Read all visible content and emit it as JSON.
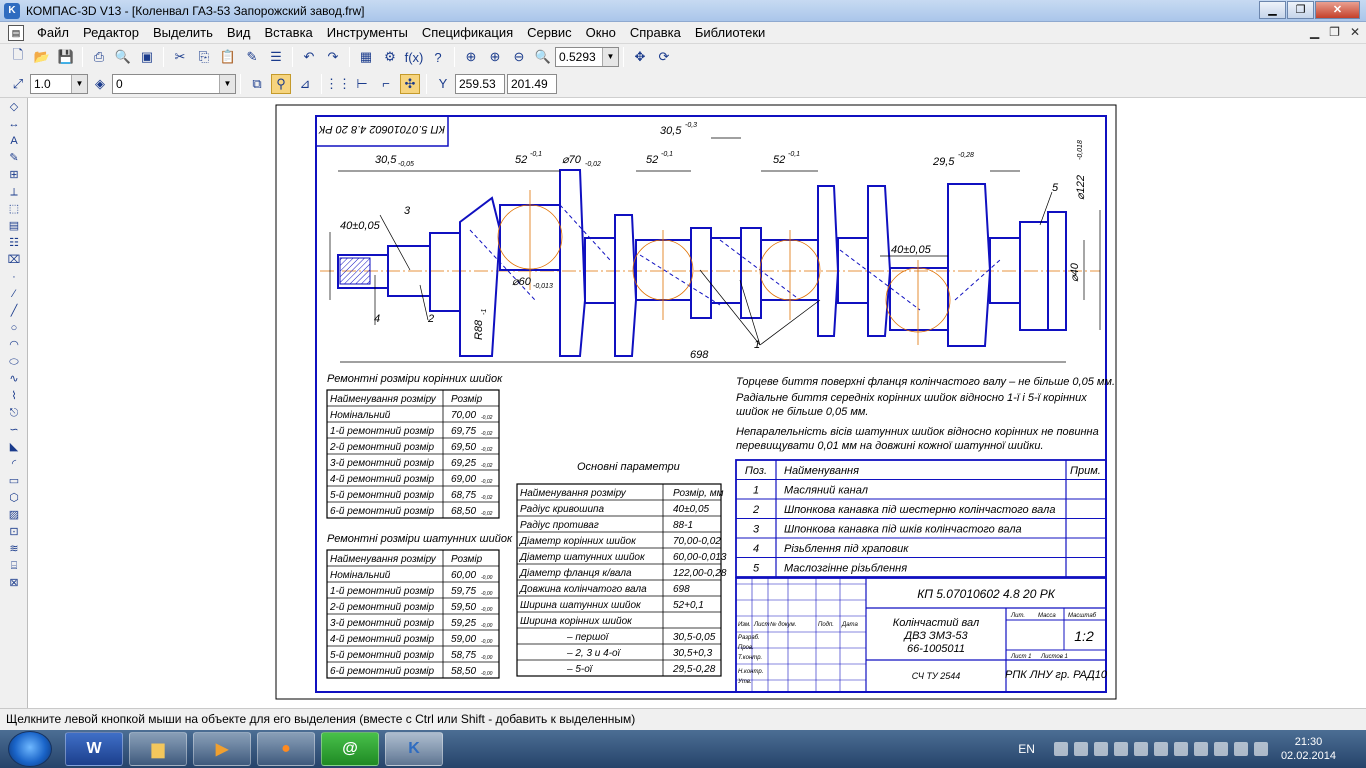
{
  "window": {
    "title": "КОМПАС-3D V13 - [Коленвал ГАЗ-53 Запорожский завод.frw]",
    "app_icon": "kompas-logo-icon"
  },
  "menu": [
    "Файл",
    "Редактор",
    "Выделить",
    "Вид",
    "Вставка",
    "Инструменты",
    "Спецификация",
    "Сервис",
    "Окно",
    "Справка",
    "Библиотеки"
  ],
  "toolbar1": {
    "zoom_value": "0.5293"
  },
  "toolbar2": {
    "scale_value": "1.0",
    "layer_value": "0",
    "coord_x": "259.53",
    "coord_y": "201.49"
  },
  "status": {
    "text": "Щелкните левой кнопкой мыши на объекте для его выделения (вместе с Ctrl или Shift - добавить к выделенным)"
  },
  "taskbar": {
    "items": [
      "W"
    ],
    "lang": "EN",
    "time": "21:30",
    "date": "02.02.2014"
  },
  "drawing": {
    "stamp_top": "КП 5.07010602 4.8 20 РК",
    "dims": {
      "d1": "30,5",
      "d1_tol": "-0,05",
      "d2": "52",
      "d2_tol": "-0,1",
      "d3": "⌀70",
      "d3_tol": "-0,02",
      "d4": "52",
      "d4_tol": "-0,1",
      "d5": "30,5",
      "d5_tol": "-0,3",
      "d6": "52",
      "d6_tol": "-0,1",
      "d7": "29,5",
      "d7_tol": "-0,28",
      "d8": "⌀122",
      "d8_tol": "-0,018",
      "d9": "40±0,05",
      "d10": "40±0,05",
      "d11": "⌀60",
      "d11_tol": "-0,013",
      "d12": "R88",
      "d12_tol": "-1",
      "d13": "⌀40",
      "d14": "698",
      "leaders": [
        "3",
        "4",
        "2",
        "1",
        "5"
      ]
    },
    "main_table": {
      "title": "Ремонтні розміри корінних шийок",
      "headers": [
        "Найменування розміру",
        "Розмір"
      ],
      "rows": [
        [
          "Номінальний",
          "70,00"
        ],
        [
          "1-й ремонтний розмір",
          "69,75"
        ],
        [
          "2-й ремонтний розмір",
          "69,50"
        ],
        [
          "3-й ремонтний розмір",
          "69,25"
        ],
        [
          "4-й ремонтний розмір",
          "69,00"
        ],
        [
          "5-й ремонтний розмір",
          "68,75"
        ],
        [
          "6-й ремонтний розмір",
          "68,50"
        ]
      ],
      "tol": "-0,02"
    },
    "rod_table": {
      "title": "Ремонтні розміри шатунних шийок",
      "headers": [
        "Найменування розміру",
        "Розмір"
      ],
      "rows": [
        [
          "Номінальний",
          "60,00"
        ],
        [
          "1-й ремонтний розмір",
          "59,75"
        ],
        [
          "2-й ремонтний розмір",
          "59,50"
        ],
        [
          "3-й ремонтний розмір",
          "59,25"
        ],
        [
          "4-й ремонтний розмір",
          "59,00"
        ],
        [
          "5-й ремонтний розмір",
          "58,75"
        ],
        [
          "6-й ремонтний розмір",
          "58,50"
        ]
      ],
      "tol": "-0,00"
    },
    "params_table": {
      "title": "Основні параметри",
      "headers": [
        "Найменування розміру",
        "Розмір, мм"
      ],
      "rows": [
        [
          "Радіус кривошипа",
          "40±0,05"
        ],
        [
          "Радіус противаг",
          "88-1"
        ],
        [
          "Діаметр корінних шийок",
          "70,00-0,02"
        ],
        [
          "Діаметр шатунних шийок",
          "60,00-0,013"
        ],
        [
          "Діаметр фланця к/вала",
          "122,00-0,28"
        ],
        [
          "Довжина колінчатого вала",
          "698"
        ],
        [
          "Ширина шатунних шийок",
          "52+0,1"
        ],
        [
          "Ширина корінних шийок",
          ""
        ],
        [
          "– першої",
          "30,5-0,05"
        ],
        [
          "– 2, 3 и 4-ої",
          "30,5+0,3"
        ],
        [
          "– 5-ої",
          "29,5-0,28"
        ]
      ]
    },
    "notes": [
      "Торцеве биття поверхні фланця колінчастого валу – не більше 0,05 мм.",
      "Радіальне биття середніх корінних шийок відносно 1-ї і 5-ї корінних",
      "шийок не більше 0,05 мм.",
      "Непаралельність вісів шатунних шийок відносно корінних не повинна",
      "перевищувати 0,01 мм на довжині кожної шатунної шийки."
    ],
    "spec_table": {
      "headers": [
        "Поз.",
        "Найменування",
        "Прим."
      ],
      "rows": [
        [
          "1",
          "Масляний канал"
        ],
        [
          "2",
          "Шпонкова канавка під шестерню колінчастого вала"
        ],
        [
          "3",
          "Шпонкова канавка під шків колінчастого вала"
        ],
        [
          "4",
          "Різьблення під храповик"
        ],
        [
          "5",
          "Маслозгінне різьблення"
        ]
      ]
    },
    "title_block": {
      "code": "КП 5.07010602 4.8 20 РК",
      "name": [
        "Колінчастий вал",
        "ДВЗ ЗМЗ-53",
        "66-1005011"
      ],
      "material": "СЧ ТУ 2544",
      "org": "РПК ЛНУ гр. РАД10",
      "scale": "1:2",
      "small": [
        "Лит.",
        "Масса",
        "Масштаб",
        "Лист 1",
        "Листов 1",
        "Разраб.",
        "Пров.",
        "Т.контр.",
        "Н.контр.",
        "Утв.",
        "Изм.",
        "Лист",
        "№ докум.",
        "Подп.",
        "Дата"
      ]
    }
  }
}
